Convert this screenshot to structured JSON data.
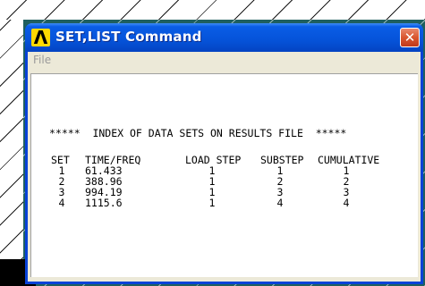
{
  "window": {
    "title": "SET,LIST Command",
    "logo_letter": "Λ"
  },
  "menu": {
    "file_label": "File"
  },
  "listing": {
    "heading": "*****  INDEX OF DATA SETS ON RESULTS FILE  *****",
    "columns": [
      "SET",
      "TIME/FREQ",
      "LOAD STEP",
      "SUBSTEP",
      "CUMULATIVE"
    ],
    "rows": [
      [
        "1",
        "61.433",
        "1",
        "1",
        "1"
      ],
      [
        "2",
        "388.96",
        "1",
        "2",
        "2"
      ],
      [
        "3",
        "994.19",
        "1",
        "3",
        "3"
      ],
      [
        "4",
        "1115.6",
        "1",
        "4",
        "4"
      ]
    ]
  },
  "colors": {
    "titlebar": "#0553d9",
    "close_button": "#d9562f",
    "window_bg": "#ece9d8",
    "logo": "#ffd800"
  }
}
